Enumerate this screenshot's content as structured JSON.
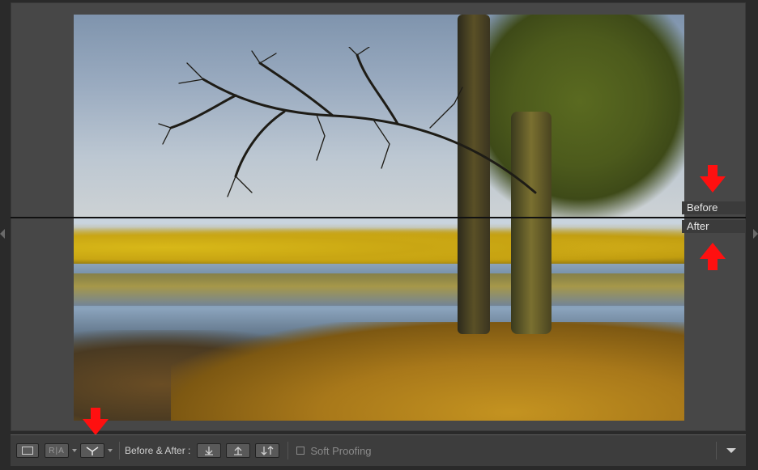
{
  "overlay": {
    "before_label": "Before",
    "after_label": "After"
  },
  "toolbar": {
    "view_loupe_icon": "loupe-view-icon",
    "view_ra_label": "R|A",
    "view_split_icon": "split-top-bottom-icon",
    "before_after_label": "Before & After :",
    "copy_before_to_after_icon": "copy-down-arrow-icon",
    "copy_after_to_before_icon": "copy-up-arrow-icon",
    "swap_icon": "swap-arrows-icon",
    "soft_proofing_label": "Soft Proofing",
    "soft_proofing_checked": false,
    "menu_icon": "chevron-down-icon"
  },
  "annotation_color": "#ff1010",
  "panel_bg": "#474747"
}
